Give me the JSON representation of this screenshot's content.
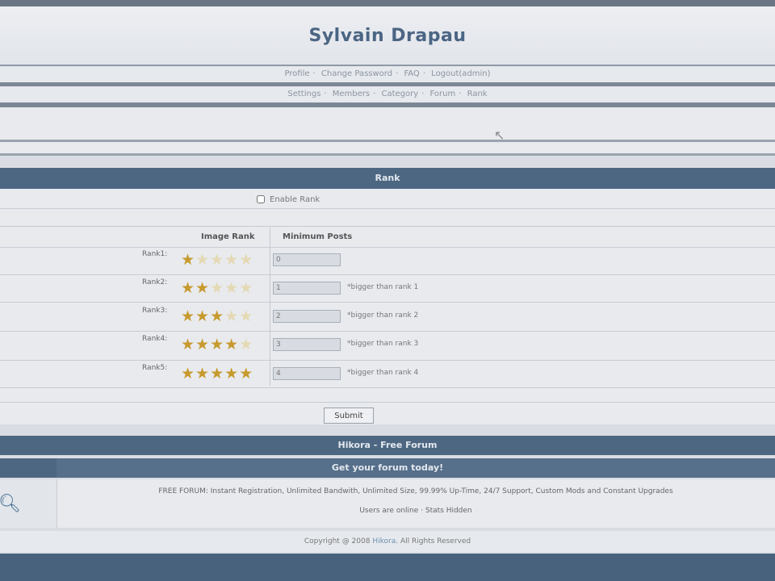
{
  "header": {
    "title": "Sylvain Drapau"
  },
  "nav_primary": [
    "Profile",
    "Change Password",
    "FAQ",
    "Logout(admin)"
  ],
  "nav_admin": [
    "Settings",
    "Members",
    "Category",
    "Forum",
    "Rank"
  ],
  "rank_panel": {
    "title": "Rank",
    "enable_label": "Enable Rank",
    "image_col": "Image Rank",
    "posts_col": "Minimum Posts",
    "submit_label": "Submit",
    "rows": [
      {
        "label": "Rank1:",
        "stars": 1,
        "posts": "0",
        "note": ""
      },
      {
        "label": "Rank2:",
        "stars": 2,
        "posts": "1",
        "note": "*bigger than rank 1"
      },
      {
        "label": "Rank3:",
        "stars": 3,
        "posts": "2",
        "note": "*bigger than rank 2"
      },
      {
        "label": "Rank4:",
        "stars": 4,
        "posts": "3",
        "note": "*bigger than rank 3"
      },
      {
        "label": "Rank5:",
        "stars": 5,
        "posts": "4",
        "note": "*bigger than rank 4"
      }
    ]
  },
  "footer": {
    "title": "Hikora - Free Forum",
    "subtitle": "Get your forum today!",
    "ad_line1": "FREE FORUM: Instant Registration, Unlimited Bandwith, Unlimited Size, 99.99% Up-Time, 24/7 Support, Custom Mods and Constant Upgrades",
    "ad_line2": "Users are online · Stats Hidden",
    "copyright_prefix": "Copyright @ 2008",
    "copyright_link": "Hikora",
    "copyright_suffix": ". All Rights Reserved"
  },
  "colors": {
    "accent": "#4d6782",
    "star_on": "#c79a2e",
    "star_off": "#e4d9b4",
    "title": "#4b6584"
  },
  "icons": {
    "star": "star-icon",
    "search": "search-icon",
    "cursor": "mouse-cursor-icon"
  }
}
